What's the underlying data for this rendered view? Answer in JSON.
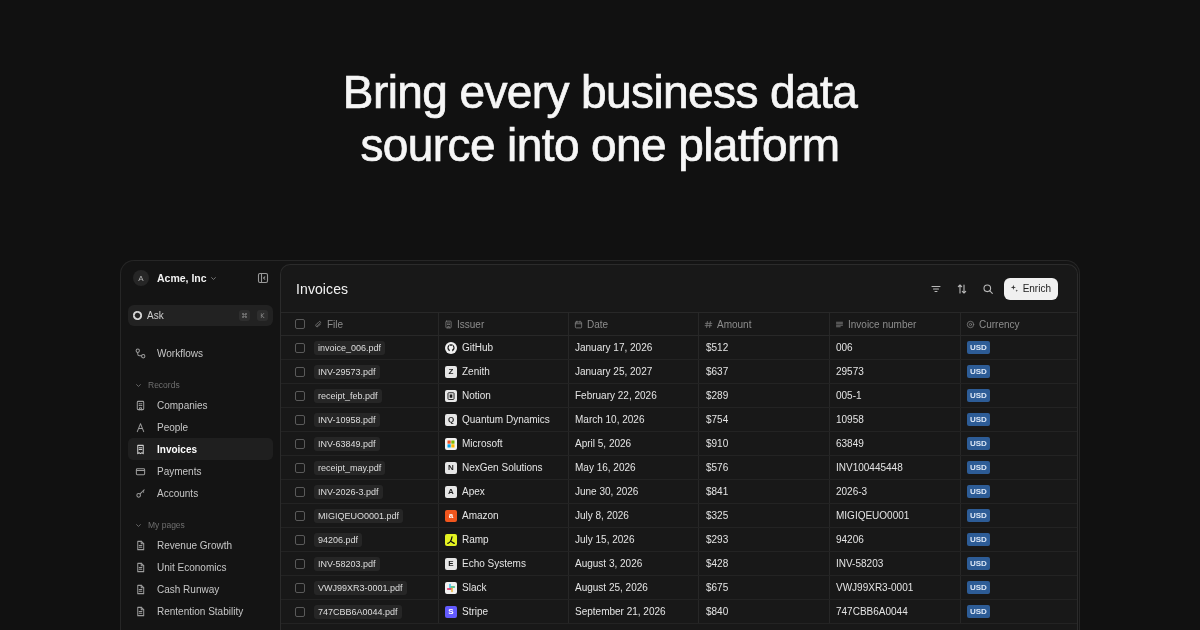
{
  "headline": "Bring every business data source into one platform",
  "sidebar": {
    "workspace": {
      "avatar": "A",
      "name": "Acme, Inc"
    },
    "ask": {
      "label": "Ask",
      "shortcut": [
        "⌘",
        "K"
      ]
    },
    "items": [
      {
        "label": "Workflows",
        "selected": false
      }
    ],
    "sections": [
      {
        "title": "Records",
        "expanded": true,
        "items": [
          {
            "label": "Companies",
            "selected": false
          },
          {
            "label": "People",
            "selected": false
          },
          {
            "label": "Invoices",
            "selected": true
          },
          {
            "label": "Payments",
            "selected": false
          },
          {
            "label": "Accounts",
            "selected": false
          }
        ]
      },
      {
        "title": "My pages",
        "expanded": true,
        "items": [
          {
            "label": "Revenue Growth",
            "selected": false
          },
          {
            "label": "Unit Economics",
            "selected": false
          },
          {
            "label": "Cash Runway",
            "selected": false
          },
          {
            "label": "Rentention Stability",
            "selected": false
          }
        ]
      }
    ]
  },
  "main": {
    "title": "Invoices",
    "enrich_button": "Enrich"
  },
  "table": {
    "select_all": {
      "checked": false
    },
    "columns": [
      {
        "label": "File"
      },
      {
        "label": "Issuer"
      },
      {
        "label": "Date"
      },
      {
        "label": "Amount"
      },
      {
        "label": "Invoice number"
      },
      {
        "label": "Currency"
      }
    ],
    "rows": [
      {
        "checked": false,
        "file": "invoice_006.pdf",
        "issuer": {
          "kind": "github",
          "name": "GitHub"
        },
        "date": "January 17, 2026",
        "amount": "$512",
        "invoice_number": "006",
        "currency": "USD"
      },
      {
        "checked": false,
        "file": "INV-29573.pdf",
        "issuer": {
          "kind": "letter",
          "letter": "Z",
          "color": "#e6e6e6",
          "name": "Zenith"
        },
        "date": "January 25, 2027",
        "amount": "$637",
        "invoice_number": "29573",
        "currency": "USD"
      },
      {
        "checked": false,
        "file": "receipt_feb.pdf",
        "issuer": {
          "kind": "notion",
          "name": "Notion"
        },
        "date": "February 22, 2026",
        "amount": "$289",
        "invoice_number": "005-1",
        "currency": "USD"
      },
      {
        "checked": false,
        "file": "INV-10958.pdf",
        "issuer": {
          "kind": "letter",
          "letter": "Q",
          "color": "#e6e6e6",
          "name": "Quantum Dynamics"
        },
        "date": "March 10, 2026",
        "amount": "$754",
        "invoice_number": "10958",
        "currency": "USD"
      },
      {
        "checked": false,
        "file": "INV-63849.pdf",
        "issuer": {
          "kind": "microsoft",
          "name": "Microsoft"
        },
        "date": "April 5, 2026",
        "amount": "$910",
        "invoice_number": "63849",
        "currency": "USD"
      },
      {
        "checked": false,
        "file": "receipt_may.pdf",
        "issuer": {
          "kind": "letter",
          "letter": "N",
          "color": "#e6e6e6",
          "name": "NexGen Solutions"
        },
        "date": "May 16, 2026",
        "amount": "$576",
        "invoice_number": "INV100445448",
        "currency": "USD"
      },
      {
        "checked": false,
        "file": "INV-2026-3.pdf",
        "issuer": {
          "kind": "letter",
          "letter": "A",
          "color": "#e6e6e6",
          "name": "Apex"
        },
        "date": "June 30, 2026",
        "amount": "$841",
        "invoice_number": "2026-3",
        "currency": "USD"
      },
      {
        "checked": false,
        "file": "MIGIQEUO0001.pdf",
        "issuer": {
          "kind": "letter",
          "letter": "a",
          "color": "#f2561d",
          "name": "Amazon"
        },
        "date": "July 8, 2026",
        "amount": "$325",
        "invoice_number": "MIGIQEUO0001",
        "currency": "USD"
      },
      {
        "checked": false,
        "file": "94206.pdf",
        "issuer": {
          "kind": "ramp",
          "name": "Ramp"
        },
        "date": "July 15, 2026",
        "amount": "$293",
        "invoice_number": "94206",
        "currency": "USD"
      },
      {
        "checked": false,
        "file": "INV-58203.pdf",
        "issuer": {
          "kind": "letter",
          "letter": "E",
          "color": "#e6e6e6",
          "name": "Echo Systems"
        },
        "date": "August 3, 2026",
        "amount": "$428",
        "invoice_number": "INV-58203",
        "currency": "USD"
      },
      {
        "checked": false,
        "file": "VWJ99XR3-0001.pdf",
        "issuer": {
          "kind": "slack",
          "name": "Slack"
        },
        "date": "August 25, 2026",
        "amount": "$675",
        "invoice_number": "VWJ99XR3-0001",
        "currency": "USD"
      },
      {
        "checked": false,
        "file": "747CBB6A0044.pdf",
        "issuer": {
          "kind": "letter",
          "letter": "S",
          "color": "#635bff",
          "name": "Stripe"
        },
        "date": "September 21, 2026",
        "amount": "$840",
        "invoice_number": "747CBB6A0044",
        "currency": "USD"
      }
    ]
  }
}
